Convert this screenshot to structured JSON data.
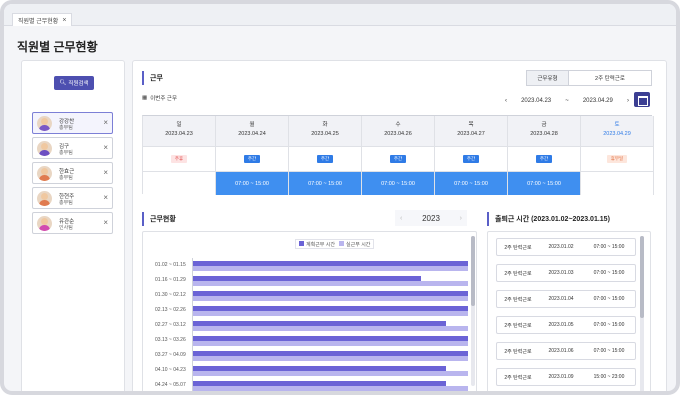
{
  "tab": {
    "label": "직원별 근무현황"
  },
  "page": {
    "title": "직원별 근무현황"
  },
  "sidebar": {
    "search_label": "직원검색",
    "employees": [
      {
        "name": "강강찬",
        "dept": "총무팀",
        "selected": true
      },
      {
        "name": "김구",
        "dept": "총무팀"
      },
      {
        "name": "한효근",
        "dept": "총무팀"
      },
      {
        "name": "한현주",
        "dept": "총무팀"
      },
      {
        "name": "유관순",
        "dept": "인사팀"
      }
    ]
  },
  "schedule": {
    "title": "근무",
    "type_label": "근무유형",
    "type_value": "2주 탄력근로",
    "week_label": "이번주 근무",
    "range_start": "2023.04.23",
    "range_sep": "~",
    "range_end": "2023.04.29",
    "days": [
      {
        "dow": "일",
        "date": "2023.04.23",
        "tag": "주휴",
        "tag_color": "red",
        "time": ""
      },
      {
        "dow": "월",
        "date": "2023.04.24",
        "tag": "주간",
        "tag_color": "blue",
        "time": "07:00 ~ 15:00"
      },
      {
        "dow": "화",
        "date": "2023.04.25",
        "tag": "주간",
        "tag_color": "blue",
        "time": "07:00 ~ 15:00"
      },
      {
        "dow": "수",
        "date": "2023.04.26",
        "tag": "주간",
        "tag_color": "blue",
        "time": "07:00 ~ 15:00"
      },
      {
        "dow": "목",
        "date": "2023.04.27",
        "tag": "주간",
        "tag_color": "blue",
        "time": "07:00 ~ 15:00"
      },
      {
        "dow": "금",
        "date": "2023.04.28",
        "tag": "주간",
        "tag_color": "blue",
        "time": "07:00 ~ 15:00"
      },
      {
        "dow": "토",
        "date": "2023.04.29",
        "tag": "휴무일",
        "tag_color": "orange",
        "time": ""
      }
    ]
  },
  "stats": {
    "title": "근무현황",
    "year": "2023",
    "legend": {
      "planned": "계획근무 시간",
      "actual": "실근무 시간"
    },
    "colors": {
      "planned": "#6b63d6",
      "actual": "#b9b5ee"
    }
  },
  "chart_data": {
    "type": "bar",
    "orientation": "horizontal",
    "categories": [
      "01.02 ~ 01.15",
      "01.16 ~ 01.29",
      "01.30 ~ 02.12",
      "02.13 ~ 02.26",
      "02.27 ~ 03.12",
      "03.13 ~ 03.26",
      "03.27 ~ 04.09",
      "04.10 ~ 04.23",
      "04.24 ~ 05.07"
    ],
    "series": [
      {
        "name": "계획근무 시간",
        "values": [
          100,
          83,
          100,
          100,
          92,
          100,
          100,
          92,
          92
        ]
      },
      {
        "name": "실근무 시간",
        "values": [
          100,
          100,
          100,
          100,
          100,
          100,
          100,
          100,
          100
        ]
      }
    ],
    "xlim": [
      0,
      100
    ]
  },
  "history": {
    "title": "출퇴근 시간 (2023.01.02~2023.01.15)",
    "rows": [
      {
        "type": "2주 탄력근로",
        "date": "2023.01.02",
        "time": "07:00 ~ 15:00"
      },
      {
        "type": "2주 탄력근로",
        "date": "2023.01.03",
        "time": "07:00 ~ 15:00"
      },
      {
        "type": "2주 탄력근로",
        "date": "2023.01.04",
        "time": "07:00 ~ 15:00"
      },
      {
        "type": "2주 탄력근로",
        "date": "2023.01.05",
        "time": "07:00 ~ 15:00"
      },
      {
        "type": "2주 탄력근로",
        "date": "2023.01.06",
        "time": "07:00 ~ 15:00"
      },
      {
        "type": "2주 탄력근로",
        "date": "2023.01.09",
        "time": "15:00 ~ 23:00"
      }
    ]
  }
}
